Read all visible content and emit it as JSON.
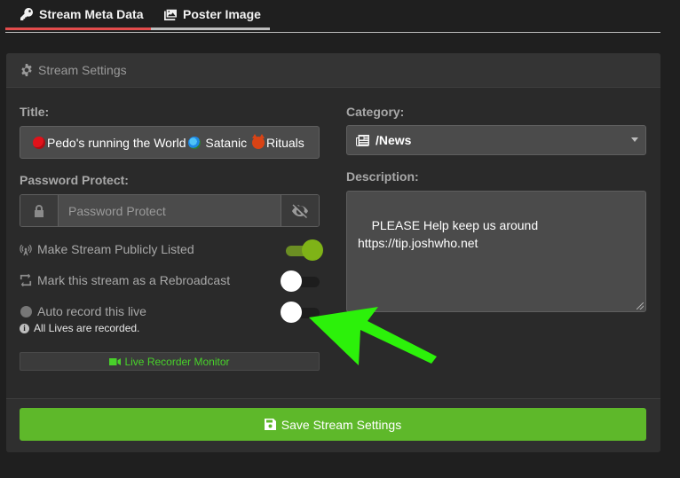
{
  "tabs": [
    {
      "label": "Stream Meta Data",
      "icon": "key-icon",
      "active": true
    },
    {
      "label": "Poster Image",
      "icon": "image-icon",
      "active": false
    }
  ],
  "card": {
    "header": "Stream Settings",
    "header_icon": "gear-icon"
  },
  "form": {
    "title_label": "Title:",
    "title_value": {
      "part1": "Pedo's running the World",
      "part2": " Satanic ",
      "part3": "Rituals"
    },
    "password_label": "Password Protect:",
    "password_placeholder": "Password Protect",
    "toggles": [
      {
        "label": "Make Stream Publicly Listed",
        "icon": "broadcast-tower-icon",
        "on": true
      },
      {
        "label": "Mark this stream as a Rebroadcast",
        "icon": "retweet-icon",
        "on": false
      },
      {
        "label": "Auto record this live",
        "icon": "record-dot-icon",
        "on": false
      }
    ],
    "auto_record_note": "All Lives are recorded.",
    "monitor_button": "Live Recorder Monitor",
    "category_label": "Category:",
    "category_value": "/News",
    "description_label": "Description:",
    "description_value": "PLEASE Help keep us around\nhttps://tip.joshwho.net",
    "save_button": "Save Stream Settings"
  },
  "colors": {
    "accent_red": "#e34c4c",
    "save_green": "#5eb82a",
    "toggle_on": "#7fb317",
    "monitor_green": "#48d12a",
    "arrow_green": "#2cf10a"
  }
}
